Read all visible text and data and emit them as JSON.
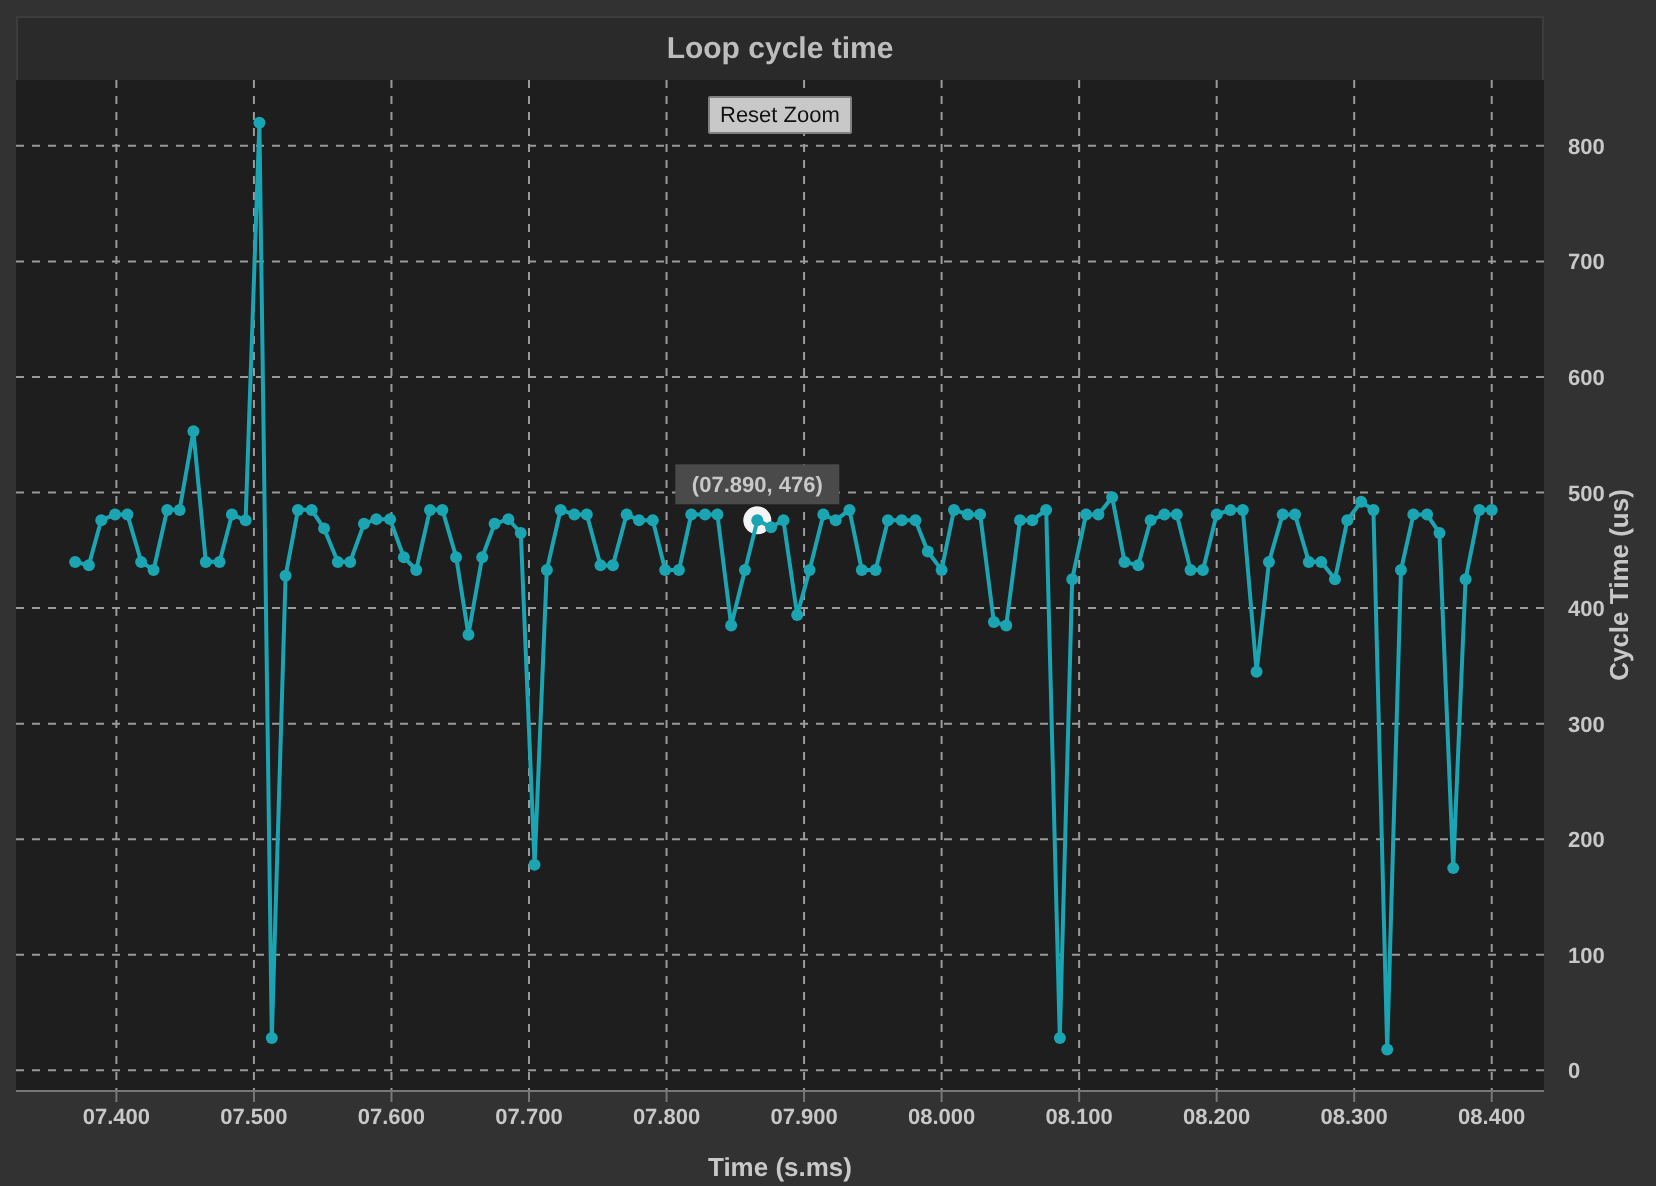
{
  "chart": {
    "reset_zoom_button": "Reset Zoom",
    "chart_data": {
      "type": "line",
      "title": "Loop cycle time",
      "xlabel": "Time (s.ms)",
      "ylabel": "Cycle Time (us)",
      "x": [
        7.37,
        7.38,
        7.389,
        7.399,
        7.408,
        7.418,
        7.427,
        7.437,
        7.446,
        7.456,
        7.465,
        7.475,
        7.484,
        7.494,
        7.504,
        7.513,
        7.523,
        7.532,
        7.542,
        7.551,
        7.561,
        7.57,
        7.58,
        7.589,
        7.599,
        7.609,
        7.618,
        7.628,
        7.637,
        7.647,
        7.656,
        7.666,
        7.675,
        7.685,
        7.694,
        7.704,
        7.713,
        7.723,
        7.733,
        7.742,
        7.752,
        7.761,
        7.771,
        7.78,
        7.79,
        7.799,
        7.809,
        7.818,
        7.828,
        7.837,
        7.847,
        7.857,
        7.866,
        7.876,
        7.885,
        7.895,
        7.904,
        7.914,
        7.923,
        7.933,
        7.942,
        7.952,
        7.961,
        7.971,
        7.981,
        7.99,
        8.0,
        8.009,
        8.019,
        8.028,
        8.038,
        8.047,
        8.057,
        8.066,
        8.076,
        8.086,
        8.095,
        8.105,
        8.114,
        8.124,
        8.133,
        8.143,
        8.152,
        8.162,
        8.171,
        8.181,
        8.19,
        8.2,
        8.21,
        8.219,
        8.229,
        8.238,
        8.248,
        8.257,
        8.267,
        8.276,
        8.286,
        8.295,
        8.305,
        8.314,
        8.324,
        8.334,
        8.343,
        8.353,
        8.362,
        8.372,
        8.381,
        8.391,
        8.4
      ],
      "grid": true,
      "series": [
        {
          "color": "#1ba5b2",
          "marker": "circle",
          "values": [
            440,
            437,
            476,
            481,
            481,
            440,
            433,
            485,
            485,
            553,
            440,
            440,
            481,
            476,
            820,
            28,
            428,
            485,
            485,
            469,
            440,
            440,
            473,
            477,
            477,
            444,
            433,
            485,
            485,
            444,
            377,
            444,
            473,
            477,
            465,
            178,
            433,
            485,
            481,
            481,
            437,
            437,
            481,
            476,
            476,
            433,
            433,
            481,
            481,
            481,
            385,
            433,
            476,
            470,
            476,
            394,
            433,
            481,
            476,
            485,
            433,
            433,
            476,
            476,
            476,
            449,
            433,
            485,
            481,
            481,
            388,
            385,
            476,
            476,
            485,
            28,
            425,
            481,
            481,
            496,
            440,
            437,
            476,
            481,
            481,
            433,
            433,
            481,
            485,
            485,
            345,
            440,
            481,
            481,
            440,
            440,
            425,
            476,
            492,
            485,
            18,
            433,
            481,
            481,
            465,
            175,
            425,
            485,
            485
          ]
        }
      ],
      "xlim": [
        7.327,
        8.438
      ],
      "ylim": [
        -17,
        857
      ],
      "xticks": [
        {
          "value": 7.4,
          "label": "07.400"
        },
        {
          "value": 7.5,
          "label": "07.500"
        },
        {
          "value": 7.6,
          "label": "07.600"
        },
        {
          "value": 7.7,
          "label": "07.700"
        },
        {
          "value": 7.8,
          "label": "07.800"
        },
        {
          "value": 7.9,
          "label": "07.900"
        },
        {
          "value": 8.0,
          "label": "08.000"
        },
        {
          "value": 8.1,
          "label": "08.100"
        },
        {
          "value": 8.2,
          "label": "08.200"
        },
        {
          "value": 8.3,
          "label": "08.300"
        },
        {
          "value": 8.4,
          "label": "08.400"
        }
      ],
      "yticks": [
        0,
        100,
        200,
        300,
        400,
        500,
        600,
        700,
        800
      ],
      "annotations": [
        {
          "x": 7.866,
          "y": 476,
          "text": "(07.890, 476)"
        }
      ]
    }
  }
}
